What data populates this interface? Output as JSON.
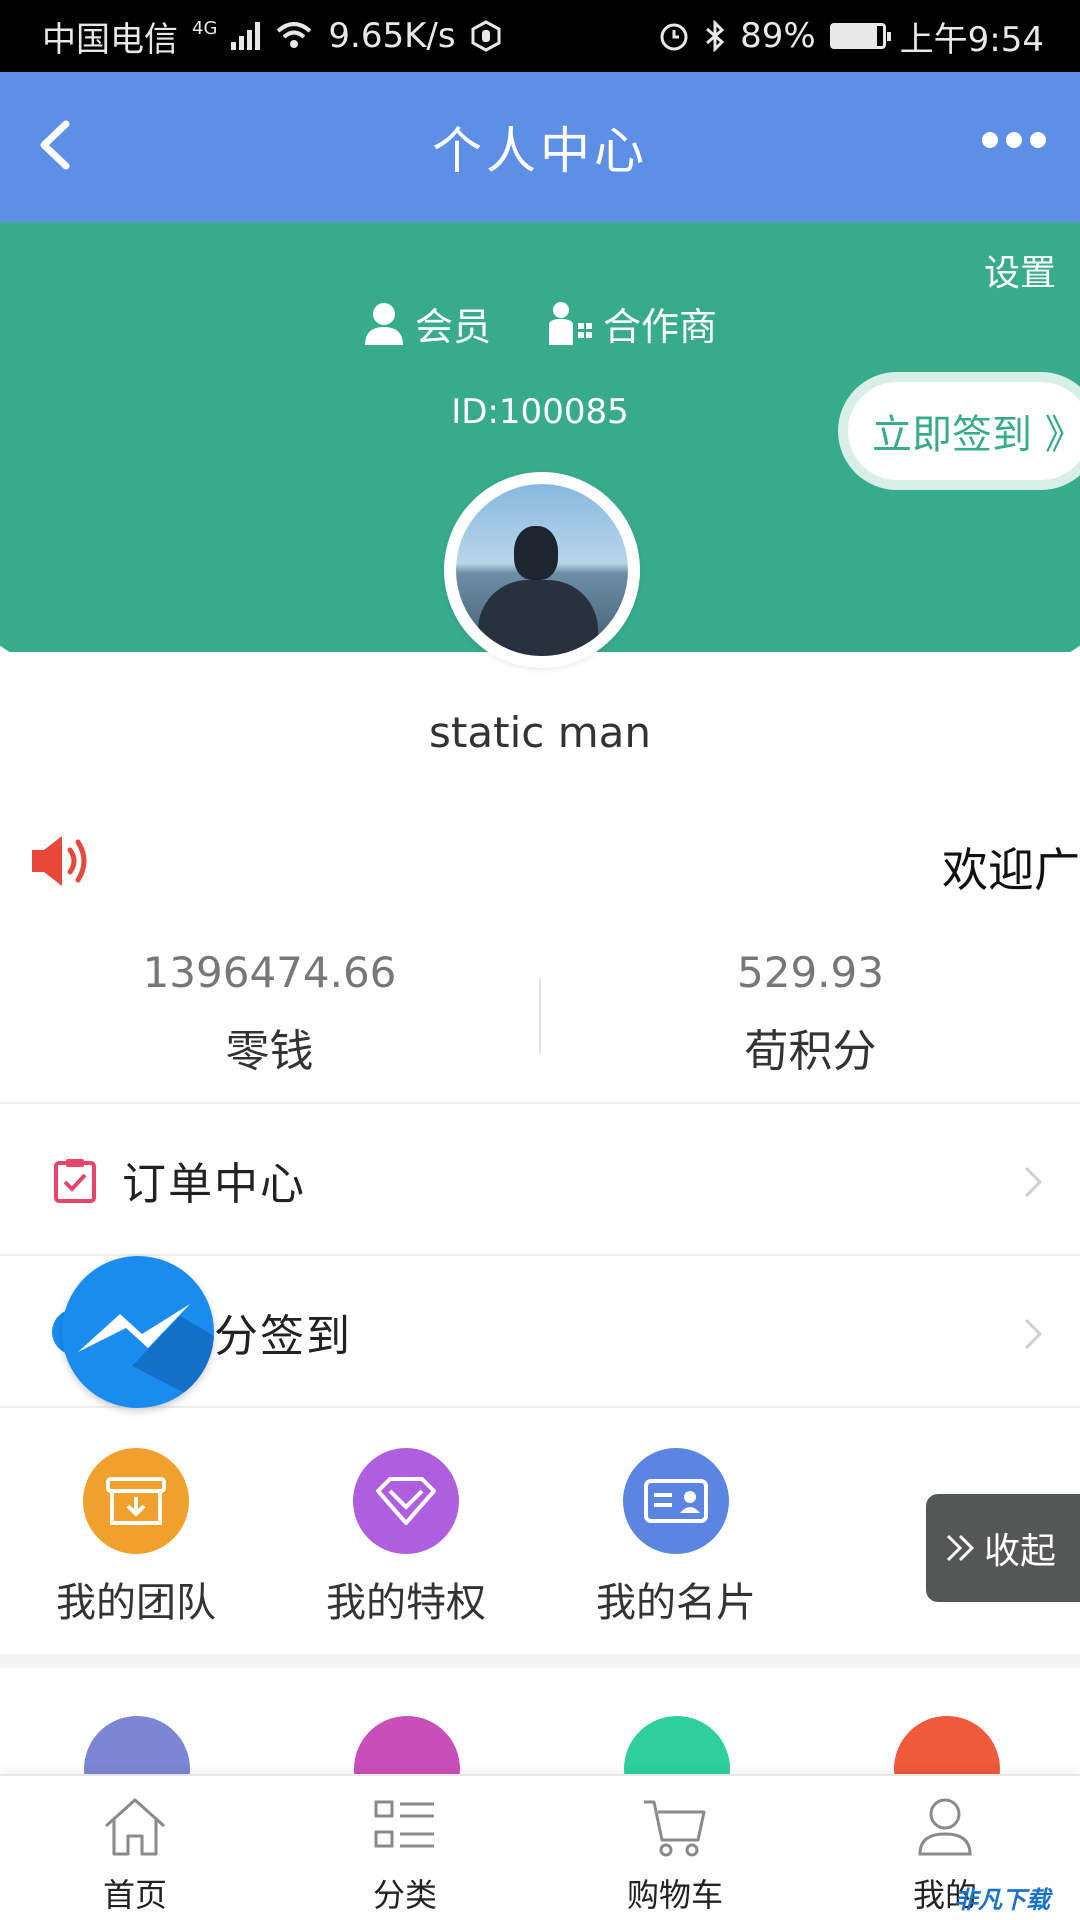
{
  "status_bar": {
    "carrier": "中国电信",
    "network": "4G",
    "speed": "9.65K/s",
    "battery": "89%",
    "battery_level": 0.89,
    "time": "上午9:54"
  },
  "nav": {
    "title": "个人中心"
  },
  "header": {
    "settings_label": "设置",
    "roles": [
      "会员",
      "合作商"
    ],
    "user_id": "ID:100085",
    "checkin_label": "立即签到 》",
    "bg_color": "#38ab8d",
    "nav_color": "#5d8fe6"
  },
  "profile": {
    "username": "static man"
  },
  "notice": {
    "text": "欢迎广"
  },
  "balances": [
    {
      "value": "1396474.66",
      "label": "零钱"
    },
    {
      "value": "529.93",
      "label": "荀积分"
    }
  ],
  "list": {
    "orders_label": "订单中心",
    "points_label": "分签到"
  },
  "grid": [
    {
      "label": "我的团队",
      "icon": "download-box-icon",
      "color": "#f0a12b"
    },
    {
      "label": "我的特权",
      "icon": "diamond-icon",
      "color": "#b05ee0"
    },
    {
      "label": "我的名片",
      "icon": "id-card-icon",
      "color": "#5b85e0"
    }
  ],
  "grid_row2_colors": [
    "#7c86d4",
    "#c94fb8",
    "#2fcf9c",
    "#ee5a3a"
  ],
  "collapse_label": "收起",
  "tabs": [
    {
      "label": "首页",
      "icon": "home-icon"
    },
    {
      "label": "分类",
      "icon": "category-list-icon"
    },
    {
      "label": "购物车",
      "icon": "cart-icon"
    },
    {
      "label": "我的",
      "icon": "user-icon"
    }
  ],
  "watermark": "非凡下载"
}
